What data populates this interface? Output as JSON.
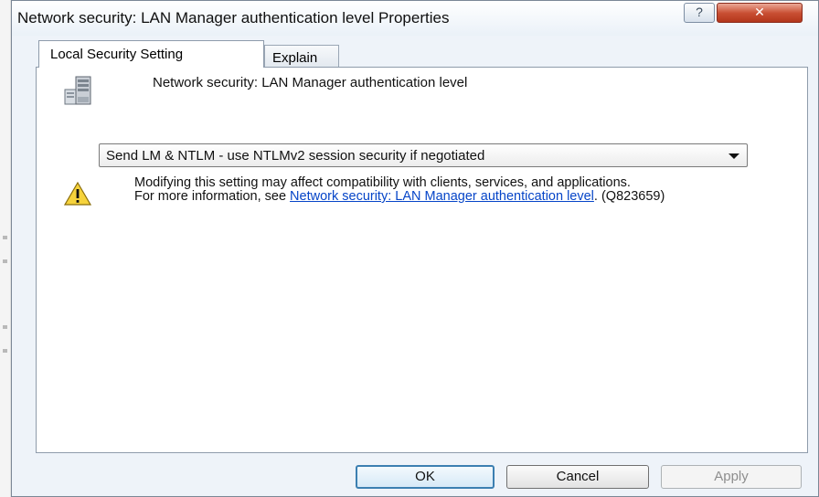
{
  "window": {
    "title": "Network security: LAN Manager authentication level Properties",
    "help_label": "?",
    "close_label": "✕"
  },
  "tabs": [
    {
      "label": "Local Security Setting",
      "active": true
    },
    {
      "label": "Explain",
      "active": false
    }
  ],
  "policy": {
    "heading": "Network security: LAN Manager authentication level",
    "icon": "server-icon"
  },
  "setting": {
    "selected": "Send LM & NTLM - use NTLMv2 session security if negotiated"
  },
  "warning": {
    "icon": "warning-icon",
    "text": "Modifying this setting may affect compatibility with clients, services, and applications.",
    "more_info_prefix": "For more information, see ",
    "link_text": "Network security: LAN Manager authentication level",
    "suffix": ". (Q823659)"
  },
  "buttons": {
    "ok": "OK",
    "cancel": "Cancel",
    "apply": "Apply"
  },
  "colors": {
    "link": "#0645c8",
    "close_button": "#c94f33",
    "default_button_border": "#3c7fb1"
  }
}
